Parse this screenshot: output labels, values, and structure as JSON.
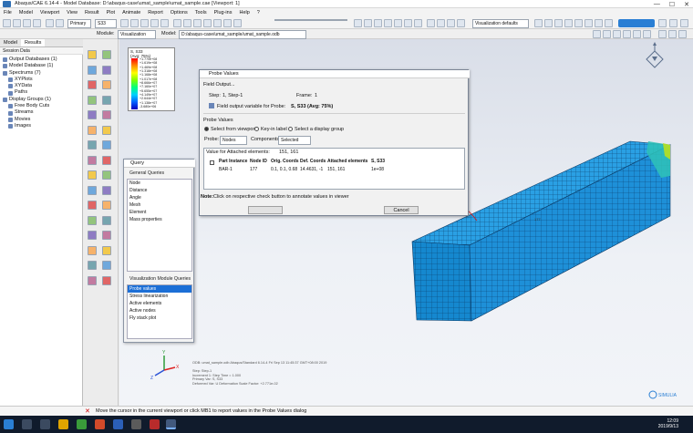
{
  "window": {
    "title": "Abaqus/CAE 6.14-4 - Model Database: D:\\abaqus-case\\umat_sample\\umat_sample.cae [Viewport: 1]",
    "controls": [
      "—",
      "☐",
      "✕"
    ]
  },
  "menu": [
    "File",
    "Model",
    "Viewport",
    "View",
    "Result",
    "Plot",
    "Animate",
    "Report",
    "Options",
    "Tools",
    "Plug-ins",
    "Help",
    "?"
  ],
  "toolbar": {
    "primary_label": "Primary",
    "variable_value": "S33",
    "search_field": "",
    "viz_defaults": "Visualization defaults"
  },
  "context_bar": {
    "module_label": "Module:",
    "module_value": "Visualization",
    "model_label": "Model:",
    "model_value": "D:/abaqus-case/umat_sample/umat_sample.odb"
  },
  "left_panel": {
    "tabs": [
      "Model",
      "Results"
    ],
    "session_label": "Session Data",
    "tree": [
      {
        "label": "Output Databases (1)",
        "indent": 0
      },
      {
        "label": "Model Database (1)",
        "indent": 0
      },
      {
        "label": "Spectrums (7)",
        "indent": 0
      },
      {
        "label": "XYPlots",
        "indent": 1
      },
      {
        "label": "XYData",
        "indent": 1
      },
      {
        "label": "Paths",
        "indent": 1
      },
      {
        "label": "Display Groups (1)",
        "indent": 0
      },
      {
        "label": "Free Body Cuts",
        "indent": 1
      },
      {
        "label": "Streams",
        "indent": 1
      },
      {
        "label": "Movies",
        "indent": 1
      },
      {
        "label": "Images",
        "indent": 1
      }
    ]
  },
  "legend": {
    "title": "S, S33",
    "subtitle": "(Avg: 75%)",
    "values": [
      "+1.770e+08",
      "+1.619e+08",
      "+1.469e+08",
      "+1.318e+08",
      "+1.168e+08",
      "+1.017e+08",
      "+8.666e+07",
      "+7.160e+07",
      "+5.655e+07",
      "+4.149e+07",
      "+2.644e+07",
      "+1.138e+07",
      "-3.680e+06"
    ]
  },
  "probe_dialog": {
    "title": "Probe Values",
    "field_output_header": "Field Output...",
    "step_label": "Step:",
    "step_value": "1, Step-1",
    "frame_label": "Frame:",
    "frame_value": "1",
    "variable_text": "Field output variable for Probe:",
    "variable_value": "S, S33 (Avg: 75%)",
    "probe_values_header": "Probe Values",
    "radios": [
      "Select from viewport",
      "Key-in label",
      "Select a display group"
    ],
    "probe_label": "Probe:",
    "probe_value": "Nodes",
    "components_label": "Components:",
    "components_value": "Selected",
    "attached_label": "Value for Attached elements:",
    "attached_value": "151, 161",
    "columns": [
      "Part Instance",
      "Node ID",
      "Orig. Coords",
      "Def. Coords",
      "Attached elements",
      "S, S33"
    ],
    "row": [
      "BAR-1",
      "177",
      "0.1, 0.1, 0.68",
      "14.4631, -1",
      "151, 161",
      "1e+08"
    ],
    "note_label": "Note:",
    "note_text": "Click on respective check button to annotate values in viewer",
    "ok_label": "",
    "cancel_label": "Cancel"
  },
  "query_dialog": {
    "title": "Query",
    "general_header": "General Queries",
    "general_items": [
      "Node",
      "Distance",
      "Angle",
      "Mesh",
      "Element",
      "Mass properties"
    ],
    "viz_header": "Visualization Module Queries",
    "viz_items": [
      "Probe values",
      "Stress linearization",
      "Active elements",
      "Active nodes",
      "Fly stack plot"
    ],
    "selected": "Probe values"
  },
  "viewport_info": {
    "lines": [
      "ODB: umat_sample.odb    Abaqus/Standard 6.14-4    Fri Sep 13 11:45:37 GMT+08:00 2019",
      "",
      "Step: Step-1",
      "Increment     1: Step Time =    1.000",
      "Primary Var: S, S33",
      "Deformed Var: U    Deformation Scale Factor: +2.771e-02"
    ]
  },
  "prompt_text": "Move the cursor in the current viewport or click MB1 to report values in the Probe Values dialog",
  "taskbar": {
    "time": "12:09",
    "date": "2019/9/13"
  },
  "colors": {
    "mesh_blue": "#1e90d8",
    "taskbar": "#101b2c",
    "selection": "#1c6fd6"
  }
}
